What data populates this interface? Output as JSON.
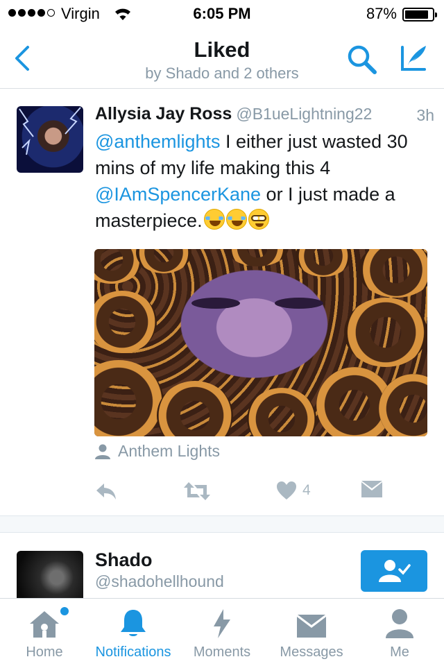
{
  "status_bar": {
    "carrier": "Virgin",
    "time": "6:05 PM",
    "battery_percent": "87%",
    "battery_level": 0.87,
    "signal_bars": 4,
    "signal_max": 5
  },
  "nav": {
    "title": "Liked",
    "subtitle": "by Shado and 2 others"
  },
  "tweet": {
    "author_name": "Allysia Jay Ross",
    "author_handle": "@B1ueLightning22",
    "time": "3h",
    "text_parts": {
      "mention1": "@anthemlights",
      "text1": " I either just wasted 30 mins of my life making this 4 ",
      "mention2": "@IAmSpencerKane",
      "text2": " or I just made a masterpiece."
    },
    "emojis": [
      "face-with-tears-of-joy",
      "face-with-tears-of-joy",
      "nerd-face"
    ],
    "attribution": "Anthem Lights",
    "like_count": "4"
  },
  "user_cell": {
    "name": "Shado",
    "handle": "@shadohellhound"
  },
  "tab_bar": {
    "tabs": [
      {
        "label": "Home",
        "icon": "home-icon"
      },
      {
        "label": "Notifications",
        "icon": "bell-icon"
      },
      {
        "label": "Moments",
        "icon": "lightning-icon"
      },
      {
        "label": "Messages",
        "icon": "envelope-icon"
      },
      {
        "label": "Me",
        "icon": "person-icon"
      }
    ],
    "active_tab": "Notifications"
  },
  "colors": {
    "accent": "#1b95e0",
    "secondary_text": "#8899a6",
    "action_gray": "#aab8c2"
  }
}
